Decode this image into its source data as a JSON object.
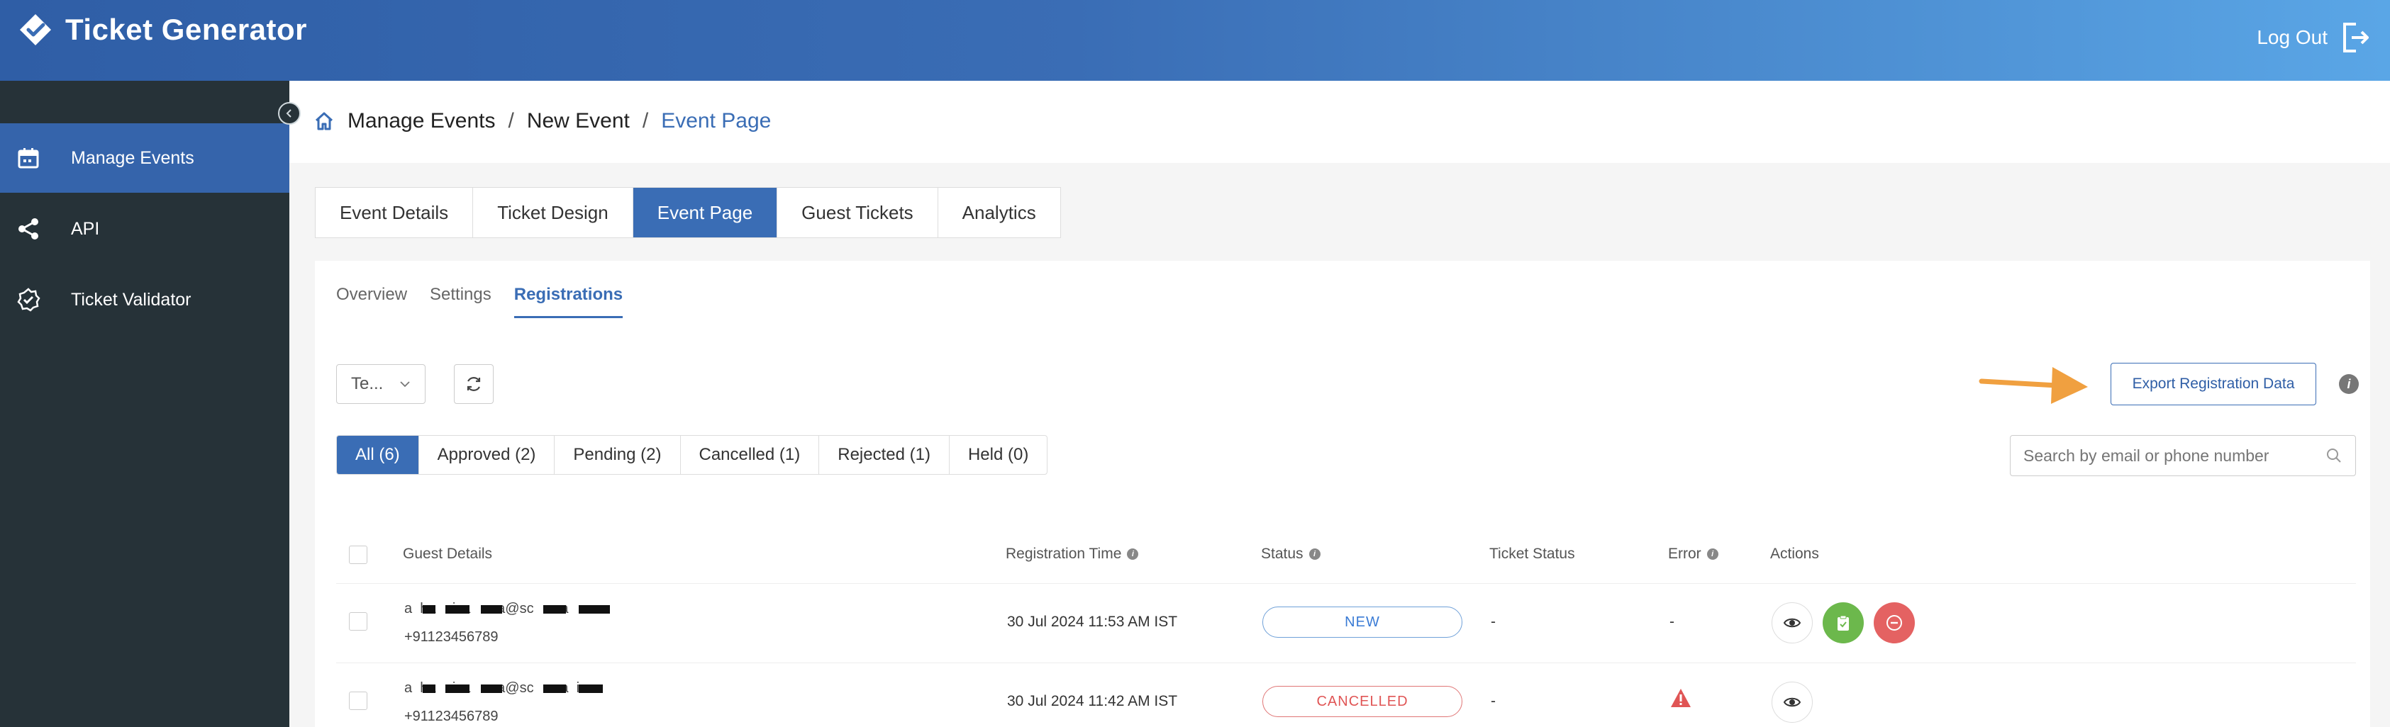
{
  "app": {
    "name": "Ticket Generator",
    "logout_label": "Log Out"
  },
  "sidebar": {
    "items": [
      {
        "label": "Manage Events",
        "icon": "calendar-icon",
        "active": true
      },
      {
        "label": "API",
        "icon": "share-nodes-icon",
        "active": false
      },
      {
        "label": "Ticket Validator",
        "icon": "badge-check-icon",
        "active": false
      }
    ]
  },
  "breadcrumb": {
    "part1": "Manage Events",
    "sep": "/",
    "part2": "New Event",
    "current": "Event Page"
  },
  "tabs": [
    {
      "label": "Event Details",
      "active": false
    },
    {
      "label": "Ticket Design",
      "active": false
    },
    {
      "label": "Event Page",
      "active": true
    },
    {
      "label": "Guest Tickets",
      "active": false
    },
    {
      "label": "Analytics",
      "active": false
    }
  ],
  "subtabs": [
    {
      "label": "Overview",
      "active": false
    },
    {
      "label": "Settings",
      "active": false
    },
    {
      "label": "Registrations",
      "active": true
    }
  ],
  "toolbar": {
    "select_value": "Te...",
    "export_label": "Export Registration Data",
    "info_glyph": "i"
  },
  "filters": [
    {
      "label": "All (6)",
      "active": true
    },
    {
      "label": "Approved (2)",
      "active": false
    },
    {
      "label": "Pending (2)",
      "active": false
    },
    {
      "label": "Cancelled (1)",
      "active": false
    },
    {
      "label": "Rejected (1)",
      "active": false
    },
    {
      "label": "Held (0)",
      "active": false
    }
  ],
  "search": {
    "placeholder": "Search by email or phone number"
  },
  "table": {
    "headers": {
      "guest": "Guest Details",
      "reg_time": "Registration Time",
      "status": "Status",
      "ticket_status": "Ticket Status",
      "error": "Error",
      "actions": "Actions"
    },
    "rows": [
      {
        "email_visible": "a  ha   riva   ava@sc   ova   ",
        "phone": "+91123456789",
        "reg_time": "30 Jul 2024 11:53 AM IST",
        "status": "NEW",
        "ticket_status": "-",
        "error": "-"
      },
      {
        "email_visible": "a  ha   riva   ava@sc   ova  i",
        "phone": "+91123456789",
        "reg_time": "30 Jul 2024 11:42 AM IST",
        "status": "CANCELLED",
        "ticket_status": "-",
        "error": ""
      }
    ]
  },
  "colors": {
    "primary": "#3a6db5",
    "sidebar": "#263238",
    "active_side": "#3564ab",
    "arrow": "#f0a040",
    "approve": "#6cb84c",
    "reject": "#e46262"
  }
}
